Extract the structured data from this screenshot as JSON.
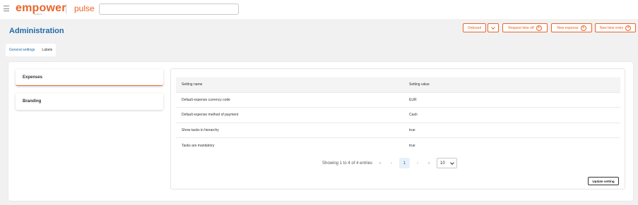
{
  "header": {
    "logo_text": "empower",
    "logo_subtext": "solutions",
    "product_name": "pulse",
    "search": {
      "value": "",
      "placeholder": ""
    }
  },
  "page": {
    "title": "Administration"
  },
  "actions": {
    "onboard_label": "Onboard",
    "request_time_off_label": "Request time off",
    "new_expense_label": "New expense",
    "new_time_entry_label": "New time entry"
  },
  "tabs": [
    {
      "label": "General settings",
      "active": true
    },
    {
      "label": "Labels",
      "active": false
    }
  ],
  "sidebar": {
    "items": [
      {
        "label": "Expenses",
        "active": true
      },
      {
        "label": "Branding",
        "active": false
      }
    ]
  },
  "table": {
    "headers": [
      "Setting name",
      "Setting value"
    ],
    "rows": [
      [
        "Default expense currency code",
        "EUR"
      ],
      [
        "Default expense method of payment",
        "Cash"
      ],
      [
        "Show tasks in hierarchy",
        "true"
      ],
      [
        "Tasks are mandatory",
        "true"
      ]
    ]
  },
  "pagination": {
    "summary": "Showing 1 to 4 of 4 entries",
    "current_page": "1",
    "page_size": "10"
  },
  "update_button_label": "Update setting",
  "colors": {
    "brand": "#e8662a",
    "accent": "#236aa7"
  },
  "icons": [
    "hamburger-icon",
    "chevron-down-icon",
    "plus-circle-icon",
    "first-page-icon",
    "prev-page-icon",
    "next-page-icon",
    "last-page-icon"
  ]
}
